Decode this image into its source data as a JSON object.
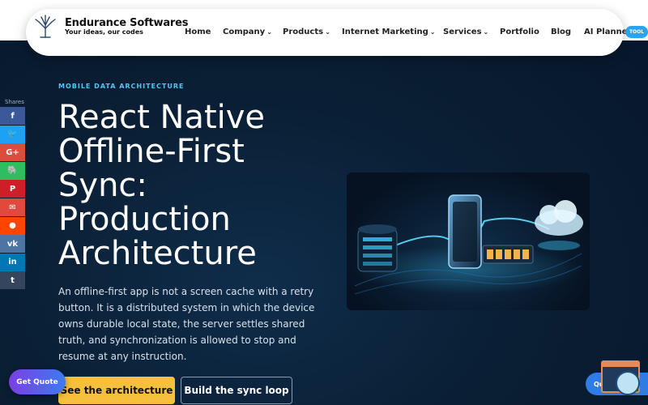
{
  "header": {
    "brand_name": "Endurance Softwares",
    "tagline": "Your ideas, our codes",
    "nav": {
      "home": "Home",
      "company": "Company",
      "products": "Products",
      "internet_marketing": "Internet Marketing",
      "services": "Services",
      "portfolio": "Portfolio",
      "blog": "Blog",
      "ai_planner": "AI Planner"
    },
    "chevron": "⌄",
    "tool_badge": "TOOL"
  },
  "share_bar": {
    "label": "Shares",
    "buttons": [
      {
        "icon": "facebook-icon",
        "glyph": "f",
        "color": "#3b5998"
      },
      {
        "icon": "twitter-icon",
        "glyph": "🐦",
        "color": "#1da1f2"
      },
      {
        "icon": "google-plus-icon",
        "glyph": "G+",
        "color": "#dd4b39"
      },
      {
        "icon": "evernote-icon",
        "glyph": "🐘",
        "color": "#2dbe60"
      },
      {
        "icon": "pinterest-icon",
        "glyph": "P",
        "color": "#cb2027"
      },
      {
        "icon": "email-icon",
        "glyph": "✉",
        "color": "#e0493b"
      },
      {
        "icon": "reddit-icon",
        "glyph": "●",
        "color": "#ff4500"
      },
      {
        "icon": "vk-icon",
        "glyph": "vk",
        "color": "#4c75a3"
      },
      {
        "icon": "linkedin-icon",
        "glyph": "in",
        "color": "#0077b5"
      },
      {
        "icon": "tumblr-icon",
        "glyph": "t",
        "color": "#35465c"
      }
    ]
  },
  "hero": {
    "eyebrow": "MOBILE DATA ARCHITECTURE",
    "headline_lines": [
      "React Native",
      "Offline-First",
      "Sync:",
      "Production",
      "Architecture"
    ],
    "lead": "An offline-first app is not a screen cache with a retry button. It is a distributed system in which the device owns durable local state, the server settles shared truth, and synchronization is allowed to stop and resume at any instruction.",
    "primary_button": "See the architecture",
    "secondary_button": "Build the sync loop"
  },
  "floating": {
    "get_quote": "Get Quote",
    "quick": "Quick"
  },
  "colors": {
    "accent": "#4fc6f5",
    "primary_button": "#f6c03c",
    "background": "#0a1f35"
  }
}
